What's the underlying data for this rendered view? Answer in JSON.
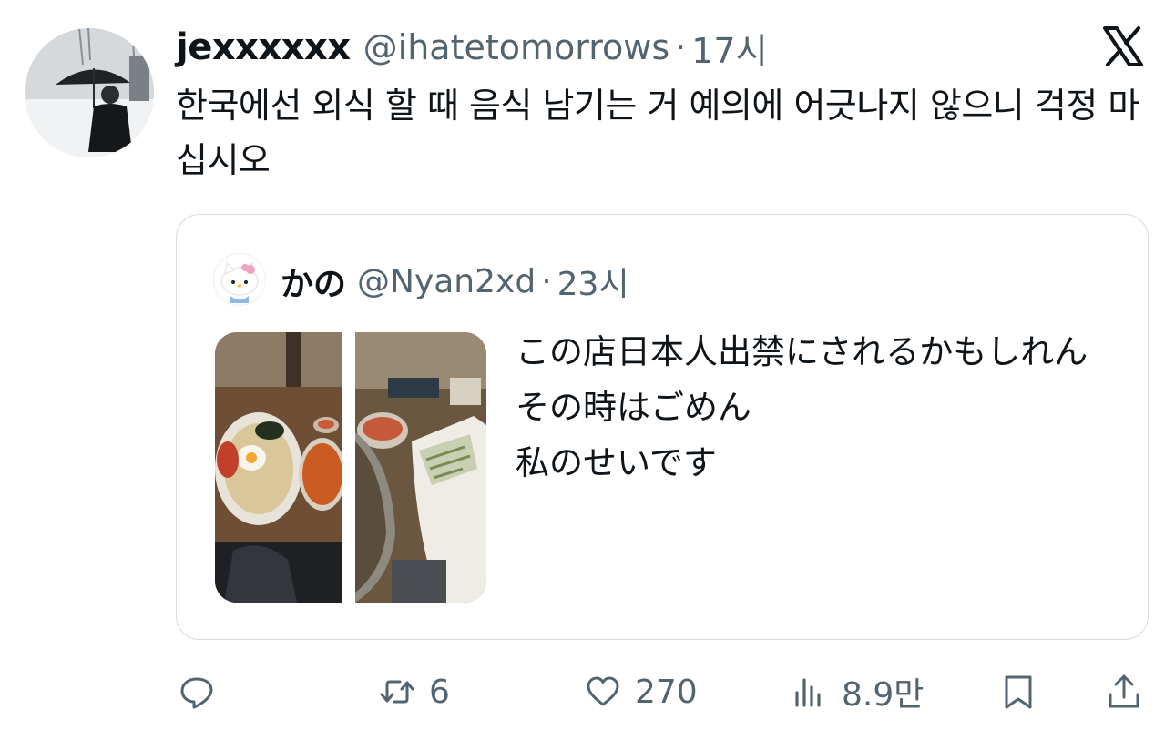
{
  "tweet": {
    "display_name": "jexxxxxx",
    "handle": "@ihatetomorrows",
    "separator": "·",
    "time": "17시",
    "text": "한국에선 외식 할 때 음식 남기는 거 예의에 어긋나지 않으니 걱정 마십시오"
  },
  "quoted": {
    "display_name": "かの",
    "handle": "@Nyan2xd",
    "separator": "·",
    "time": "23시",
    "text": "この店日本人出禁にされるかもしれん\nその時はごめん\n私のせいです"
  },
  "actions": {
    "reply_icon": "reply-icon",
    "retweet_count": "6",
    "like_count": "270",
    "view_count": "8.9만",
    "bookmark_icon": "bookmark-icon",
    "share_icon": "share-icon"
  },
  "colors": {
    "text": "#0f1419",
    "secondary": "#536471",
    "border": "#d5dbe0"
  }
}
